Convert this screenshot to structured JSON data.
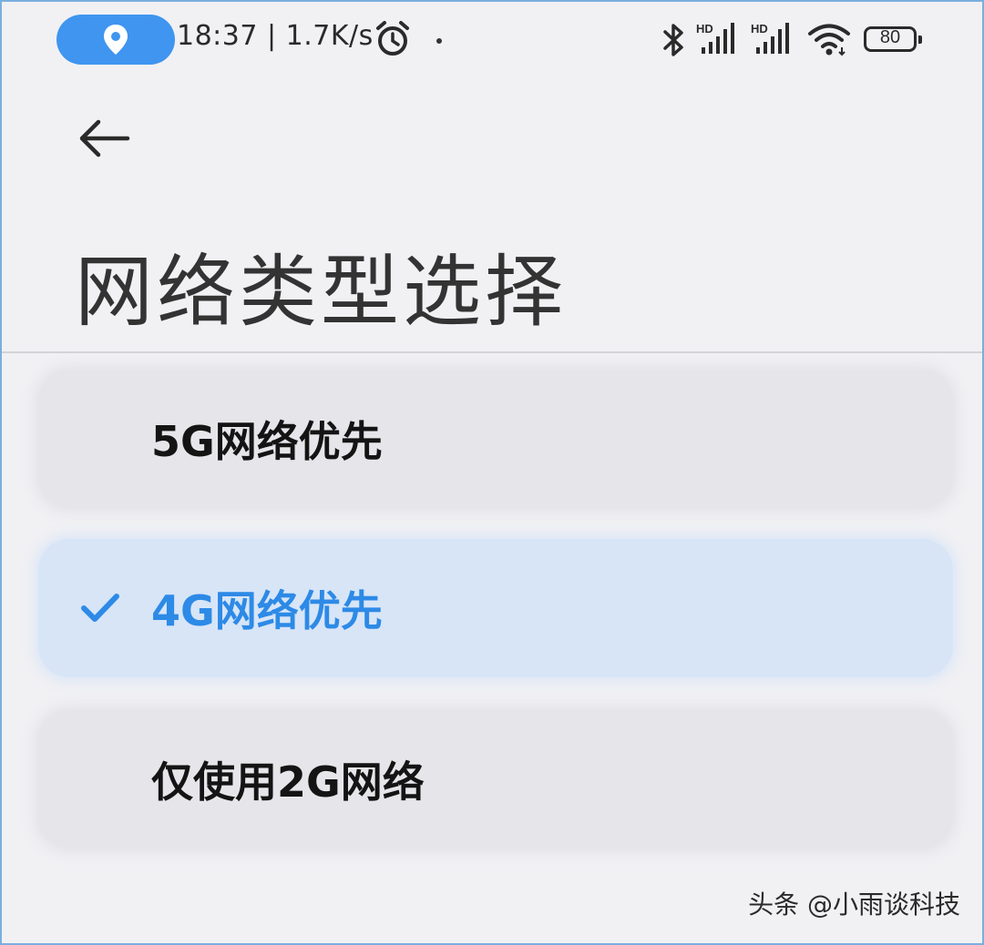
{
  "status_bar": {
    "time_speed": "18:37 | 1.7K/s",
    "signal_1_label": "HD",
    "signal_2_label": "HD",
    "battery_level": "80",
    "location_pill_color": "#3f95ef"
  },
  "header": {
    "back_icon": "arrow-left-icon",
    "title": "网络类型选择"
  },
  "options": [
    {
      "label": "5G网络优先",
      "selected": false
    },
    {
      "label": "4G网络优先",
      "selected": true
    },
    {
      "label": "仅使用2G网络",
      "selected": false
    }
  ],
  "colors": {
    "accent": "#2d8ae6",
    "selected_bg": "#d7e5f7",
    "option_bg": "#e6e6ea",
    "page_bg": "#f1f1f4"
  },
  "watermark": "头条 @小雨谈科技"
}
